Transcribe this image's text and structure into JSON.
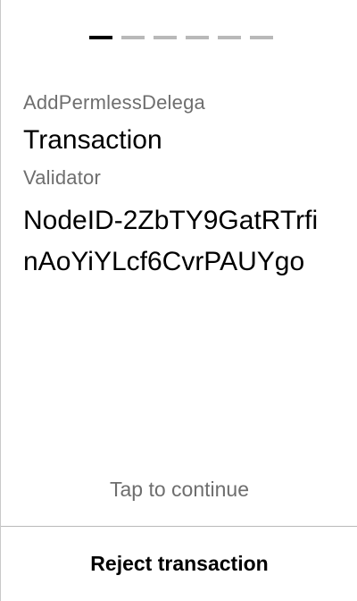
{
  "progress": {
    "total_steps": 6,
    "current_step": 1
  },
  "fields": {
    "type_label": "AddPermlessDelega",
    "type_value": "Transaction",
    "validator_label": "Validator",
    "validator_value": "NodeID-2ZbTY9GatRTrfinAoYiYLcf6CvrPAUYgo"
  },
  "footer": {
    "tap_hint": "Tap to continue",
    "reject_label": "Reject transaction"
  },
  "colors": {
    "background": "#ffffff",
    "primary_text": "#000000",
    "secondary_text": "#6e6e6e",
    "inactive_segment": "#b9b9b9",
    "active_segment": "#000000"
  }
}
